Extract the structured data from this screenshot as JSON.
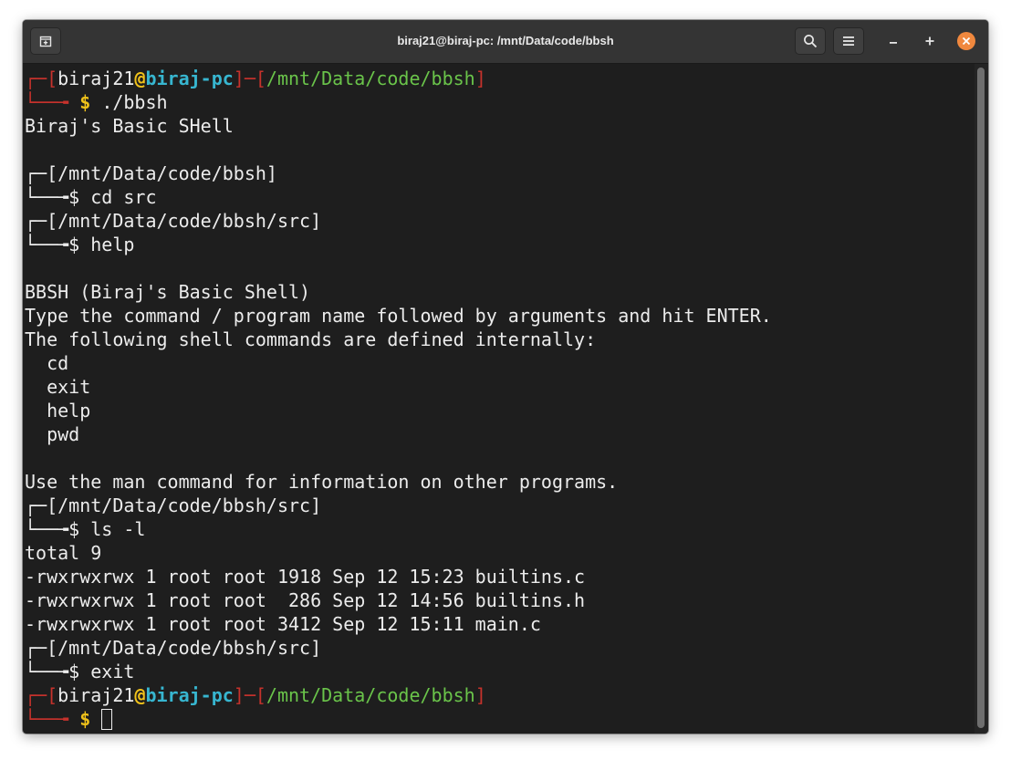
{
  "window": {
    "title": "biraj21@biraj-pc: /mnt/Data/code/bbsh",
    "new_tab_icon": "new-tab-icon",
    "search_icon": "search-icon",
    "menu_icon": "hamburger-menu-icon",
    "minimize_icon": "minimize-icon",
    "maximize_icon": "plus-icon",
    "close_icon": "close-icon"
  },
  "colors": {
    "terminal_bg": "#1e1e1e",
    "titlebar_bg": "#343434",
    "close_button": "#f0883e",
    "prompt_red": "#c7322c",
    "prompt_green": "#6ac44a",
    "prompt_yellow": "#f0c21a",
    "prompt_cyan": "#37b6d0"
  },
  "prompt": {
    "user": "biraj21",
    "at": "@",
    "host": "biraj-pc",
    "dollar": "$",
    "bbsh_top": "┌─[",
    "bbsh_bottom": "└──╼",
    "bbsh_dir_open": "[",
    "bbsh_dir_close": "]"
  },
  "session": {
    "p1_dir": "/mnt/Data/code/bbsh",
    "p1_cmd": "./bbsh",
    "banner": "Biraj's Basic SHell",
    "p2_dir": "/mnt/Data/code/bbsh",
    "p2_cmd": "cd src",
    "p3_dir": "/mnt/Data/code/bbsh/src",
    "p3_cmd": "help",
    "help_title": "BBSH (Biraj's Basic Shell)",
    "help_line1": "Type the command / program name followed by arguments and hit ENTER.",
    "help_line2": "The following shell commands are defined internally:",
    "builtins": [
      "cd",
      "exit",
      "help",
      "pwd"
    ],
    "help_footer": "Use the man command for information on other programs.",
    "p4_dir": "/mnt/Data/code/bbsh/src",
    "p4_cmd": "ls -l",
    "ls_total": "total 9",
    "ls_rows": [
      "-rwxrwxrwx 1 root root 1918 Sep 12 15:23 builtins.c",
      "-rwxrwxrwx 1 root root  286 Sep 12 14:56 builtins.h",
      "-rwxrwxrwx 1 root root 3412 Sep 12 15:11 main.c"
    ],
    "p5_dir": "/mnt/Data/code/bbsh/src",
    "p5_cmd": "exit",
    "p6_dir": "/mnt/Data/code/bbsh"
  }
}
